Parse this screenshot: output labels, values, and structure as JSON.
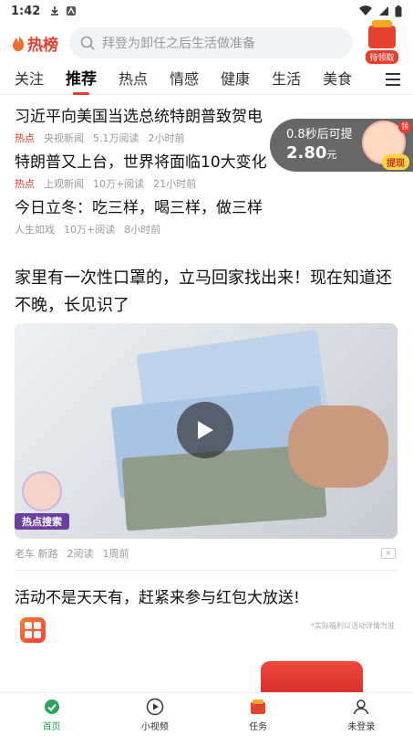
{
  "status_bar": {
    "time": "1:42"
  },
  "header": {
    "logo_text": "热榜",
    "search_placeholder": "拜登为卸任之后生活做准备",
    "gift_label": "待领取"
  },
  "tabs": [
    "关注",
    "推荐",
    "热点",
    "情感",
    "健康",
    "生活",
    "美食"
  ],
  "active_tab": "推荐",
  "news": [
    {
      "title": "习近平向美国当选总统特朗普致贺电",
      "tag": "热点",
      "source": "央视新闻",
      "reads": "5.1万阅读",
      "time": "2小时前"
    },
    {
      "title": "特朗普又上台，世界将面临10大变化",
      "tag": "热点",
      "source": "上观新闻",
      "reads": "10万+阅读",
      "time": "21小时前"
    },
    {
      "title": "今日立冬：吃三样，喝三样，做三样",
      "tag": "",
      "source": "人生如戏",
      "reads": "10万+阅读",
      "time": "8小时前"
    }
  ],
  "float_redpack": {
    "countdown": "0.8秒后可提",
    "amount": "2.80",
    "unit": "元",
    "claim_label": "提现",
    "badge": "领"
  },
  "article": {
    "title": "家里有一次性口罩的，立马回家找出来！现在知道还不晚，长见识了",
    "hot_search_label": "热点搜索",
    "source": "老车 新路",
    "reads": "2阅读",
    "time": "1周前"
  },
  "promo": {
    "title": "活动不是天天有，赶紧来参与红包大放送!",
    "note": "*实际福利以活动详情为准"
  },
  "bottom_nav": [
    {
      "label": "首页",
      "icon": "home-icon"
    },
    {
      "label": "小视频",
      "icon": "play-circle-icon"
    },
    {
      "label": "任务",
      "icon": "task-icon"
    },
    {
      "label": "未登录",
      "icon": "user-icon"
    }
  ],
  "colors": {
    "accent": "#e63b2e",
    "nav_active": "#2aa55a"
  }
}
